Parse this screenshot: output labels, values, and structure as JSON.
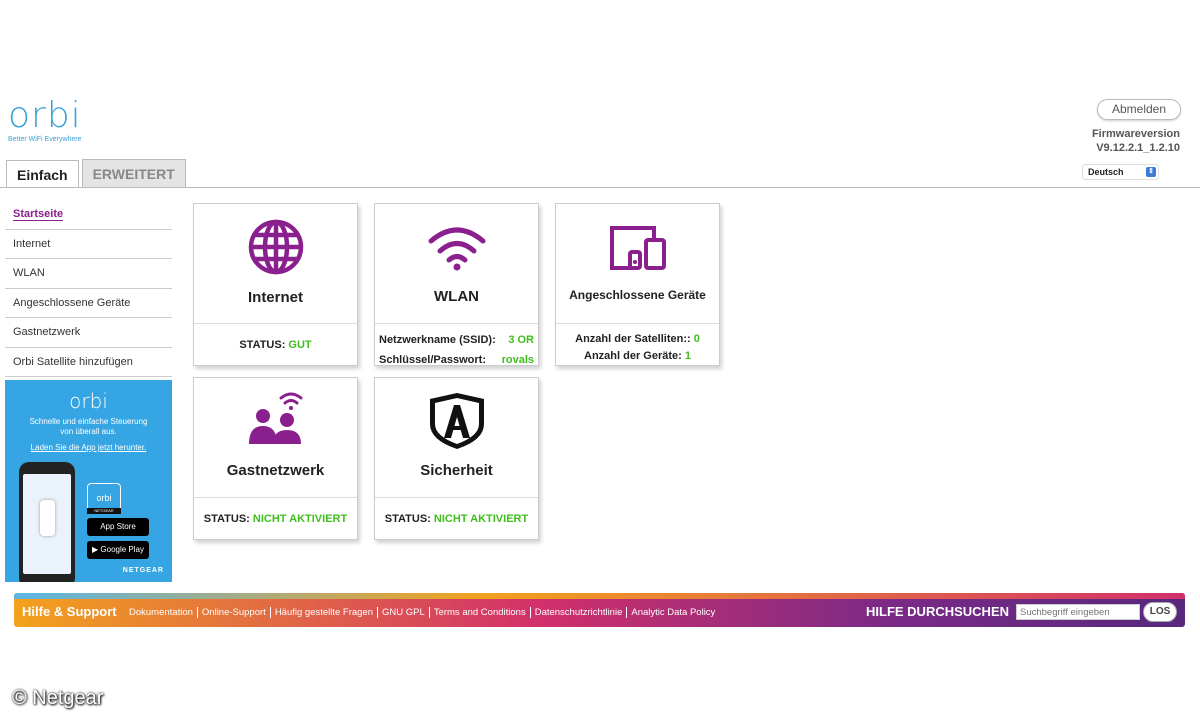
{
  "brand": {
    "logo": "orbi",
    "tagline": "Better WiFi Everywhere"
  },
  "header": {
    "logout_label": "Abmelden",
    "firmware_label": "Firmwareversion",
    "firmware_value": "V9.12.2.1_1.2.10",
    "language": "Deutsch"
  },
  "tabs": [
    {
      "label": "Einfach",
      "active": true
    },
    {
      "label": "ERWEITERT",
      "active": false
    }
  ],
  "sidebar": {
    "items": [
      {
        "label": "Startseite",
        "active": true
      },
      {
        "label": "Internet"
      },
      {
        "label": "WLAN"
      },
      {
        "label": "Angeschlossene Geräte"
      },
      {
        "label": "Gastnetzwerk"
      },
      {
        "label": "Orbi Satellite hinzufügen"
      }
    ],
    "promo": {
      "logo": "orbi",
      "text1": "Schnelle und einfache Steuerung",
      "text2": "von überall aus.",
      "link": "Laden Sie die App jetzt herunter.",
      "app_store": "App Store",
      "google_play": "Google Play",
      "brand": "NETGEAR"
    }
  },
  "cards": {
    "internet": {
      "title": "Internet",
      "status_label": "STATUS:",
      "status_value": "GUT"
    },
    "wlan": {
      "title": "WLAN",
      "ssid_label": "Netzwerkname (SSID):",
      "ssid_value": "3 OR",
      "pw_label": "Schlüssel/Passwort:",
      "pw_value": "rovals"
    },
    "devices": {
      "title": "Angeschlossene Geräte",
      "satellites_label": "Anzahl der Satelliten::",
      "satellites_value": "0",
      "devices_label": "Anzahl der Geräte:",
      "devices_value": "1"
    },
    "guest": {
      "title": "Gastnetzwerk",
      "status_label": "STATUS:",
      "status_value": "NICHT AKTIVIERT"
    },
    "security": {
      "title": "Sicherheit",
      "status_label": "STATUS:",
      "status_value": "NICHT AKTIVIERT"
    }
  },
  "footer": {
    "help_title": "Hilfe & Support",
    "links": [
      "Dokumentation",
      "Online-Support",
      "Häufig gestellte Fragen",
      "GNU GPL",
      "Terms and Conditions",
      "Datenschutzrichtlinie",
      "Analytic Data Policy"
    ],
    "search_title": "HILFE DURCHSUCHEN",
    "search_placeholder": "Suchbegriff eingeben",
    "search_button": "LOS"
  },
  "watermark": "© Netgear",
  "colors": {
    "accent": "#8a1f8e",
    "status_green": "#3fbf1b",
    "brand_blue": "#3aa4db"
  }
}
